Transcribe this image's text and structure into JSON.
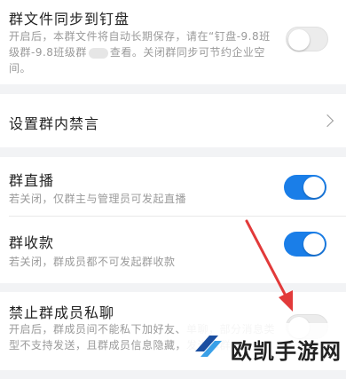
{
  "sync": {
    "title": "群文件同步到钉盘",
    "desc_part1": "开启后，本群文件将自动长期保存，请在“钉盘-9.8班级群-9.8班级群",
    "desc_part2": "查看。关闭群同步可节约企业空间。",
    "toggle": "off"
  },
  "mute": {
    "title": "设置群内禁言"
  },
  "live": {
    "title": "群直播",
    "desc": "若关闭，仅群主与管理员可发起直播",
    "toggle": "on"
  },
  "collect": {
    "title": "群收款",
    "desc": "若关闭，群成员都不可发起群收款",
    "toggle": "on"
  },
  "private_chat": {
    "title": "禁止群成员私聊",
    "desc": "开启后，群成员间不能私下加好友、单聊，部分消息类型不支持发送，且群成员信息隐藏，发进本群",
    "toggle": "off"
  },
  "watermark": {
    "text": "欧凯手游网"
  },
  "colors": {
    "accent": "#1a7ee8",
    "arrow": "#e23a3a"
  }
}
